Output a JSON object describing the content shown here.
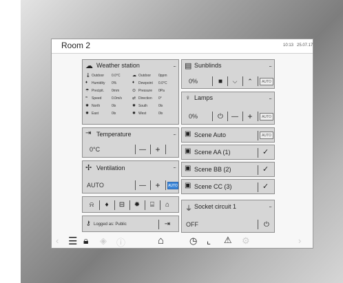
{
  "room": {
    "title": "Room 2",
    "time": "10:13",
    "date": "25.07.17"
  },
  "weather": {
    "title": "Weather station",
    "rows": [
      [
        {
          "label": "Outdoor",
          "value": "0.0°C"
        },
        {
          "label": "Outdoor",
          "value": "0ppm"
        }
      ],
      [
        {
          "label": "Humidity",
          "value": "0%"
        },
        {
          "label": "Dewpoint",
          "value": "0.0°C"
        }
      ],
      [
        {
          "label": "Precipit.",
          "value": "0mm"
        },
        {
          "label": "Pressure",
          "value": "0Pa"
        }
      ],
      [
        {
          "label": "Speed",
          "value": "0.0m/s"
        },
        {
          "label": "Direction",
          "value": "0°"
        }
      ],
      [
        {
          "label": "North",
          "value": "0lx"
        },
        {
          "label": "South",
          "value": "0lx"
        }
      ],
      [
        {
          "label": "East",
          "value": "0lx"
        },
        {
          "label": "West",
          "value": "0lx"
        }
      ]
    ]
  },
  "sunblinds": {
    "title": "Sunblinds",
    "value": "0%",
    "auto": "AUTO"
  },
  "lamps": {
    "title": "Lamps",
    "value": "0%",
    "minus": "—",
    "plus": "+",
    "auto": "AUTO"
  },
  "temperature": {
    "title": "Temperature",
    "value": "0°C",
    "minus": "—",
    "plus": "+"
  },
  "ventilation": {
    "title": "Ventilation",
    "value": "AUTO",
    "minus": "—",
    "plus": "+",
    "auto": "AUTO",
    "auto_active_color": "#3b86d8"
  },
  "scenes": [
    {
      "label": "Scene Auto",
      "control": "AUTO"
    },
    {
      "label": "Scene AA (1)",
      "control": "✓"
    },
    {
      "label": "Scene BB (2)",
      "control": "✓"
    },
    {
      "label": "Scene CC (3)",
      "control": "✓"
    }
  ],
  "socket": {
    "title": "Socket circuit 1",
    "value": "OFF"
  },
  "login": {
    "text": "Logged as: Public"
  },
  "more_dots": "..."
}
